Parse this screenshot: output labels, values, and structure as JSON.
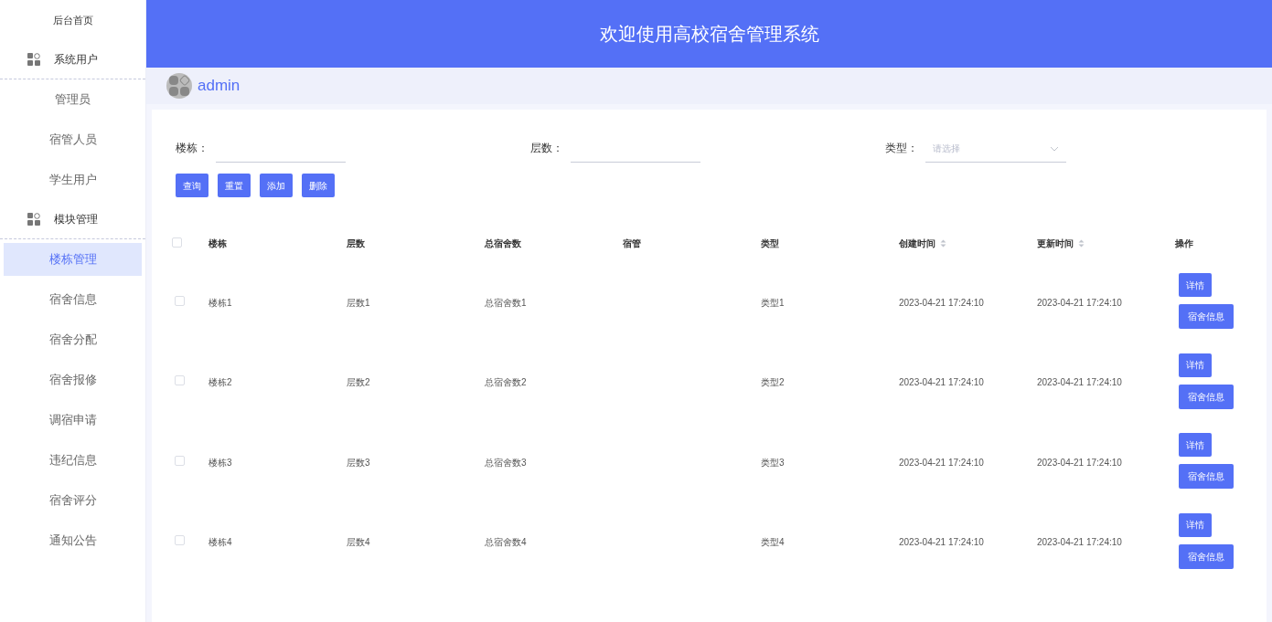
{
  "sidebar": {
    "home": "后台首页",
    "groups": [
      {
        "title": "系统用户",
        "items": [
          {
            "label": "管理员",
            "selected": false
          },
          {
            "label": "宿管人员",
            "selected": false
          },
          {
            "label": "学生用户",
            "selected": false
          }
        ]
      },
      {
        "title": "模块管理",
        "items": [
          {
            "label": "楼栋管理",
            "selected": true
          },
          {
            "label": "宿舍信息",
            "selected": false
          },
          {
            "label": "宿舍分配",
            "selected": false
          },
          {
            "label": "宿舍报修",
            "selected": false
          },
          {
            "label": "调宿申请",
            "selected": false
          },
          {
            "label": "违纪信息",
            "selected": false
          },
          {
            "label": "宿舍评分",
            "selected": false
          },
          {
            "label": "通知公告",
            "selected": false
          }
        ]
      }
    ]
  },
  "header": {
    "title": "欢迎使用高校宿舍管理系统"
  },
  "user": {
    "name": "admin"
  },
  "filters": [
    {
      "kind": "text",
      "label": "楼栋："
    },
    {
      "kind": "text",
      "label": "层数："
    },
    {
      "kind": "select",
      "label": "类型：",
      "placeholder": "请选择"
    }
  ],
  "actions": [
    "查询",
    "重置",
    "添加",
    "删除"
  ],
  "table": {
    "all_checked": false,
    "columns": [
      {
        "label": "楼栋",
        "kind": "plain"
      },
      {
        "label": "层数",
        "kind": "plain"
      },
      {
        "label": "总宿舍数",
        "kind": "plain"
      },
      {
        "label": "宿管",
        "kind": "plain"
      },
      {
        "label": "类型",
        "kind": "plain"
      },
      {
        "label": "创建时间",
        "kind": "sortable"
      },
      {
        "label": "更新时间",
        "kind": "sortable"
      },
      {
        "label": "操作",
        "kind": "plain"
      }
    ],
    "rows": [
      {
        "checked": false,
        "cells": [
          "楼栋1",
          "层数1",
          "总宿舍数1",
          "",
          "类型1",
          "2023-04-21 17:24:10",
          "2023-04-21 17:24:10"
        ],
        "buttons": [
          "详情",
          "宿舍信息"
        ]
      },
      {
        "checked": false,
        "cells": [
          "楼栋2",
          "层数2",
          "总宿舍数2",
          "",
          "类型2",
          "2023-04-21 17:24:10",
          "2023-04-21 17:24:10"
        ],
        "buttons": [
          "详情",
          "宿舍信息"
        ]
      },
      {
        "checked": false,
        "cells": [
          "楼栋3",
          "层数3",
          "总宿舍数3",
          "",
          "类型3",
          "2023-04-21 17:24:10",
          "2023-04-21 17:24:10"
        ],
        "buttons": [
          "详情",
          "宿舍信息"
        ]
      },
      {
        "checked": false,
        "cells": [
          "楼栋4",
          "层数4",
          "总宿舍数4",
          "",
          "类型4",
          "2023-04-21 17:24:10",
          "2023-04-21 17:24:10"
        ],
        "buttons": [
          "详情",
          "宿舍信息"
        ]
      }
    ]
  }
}
